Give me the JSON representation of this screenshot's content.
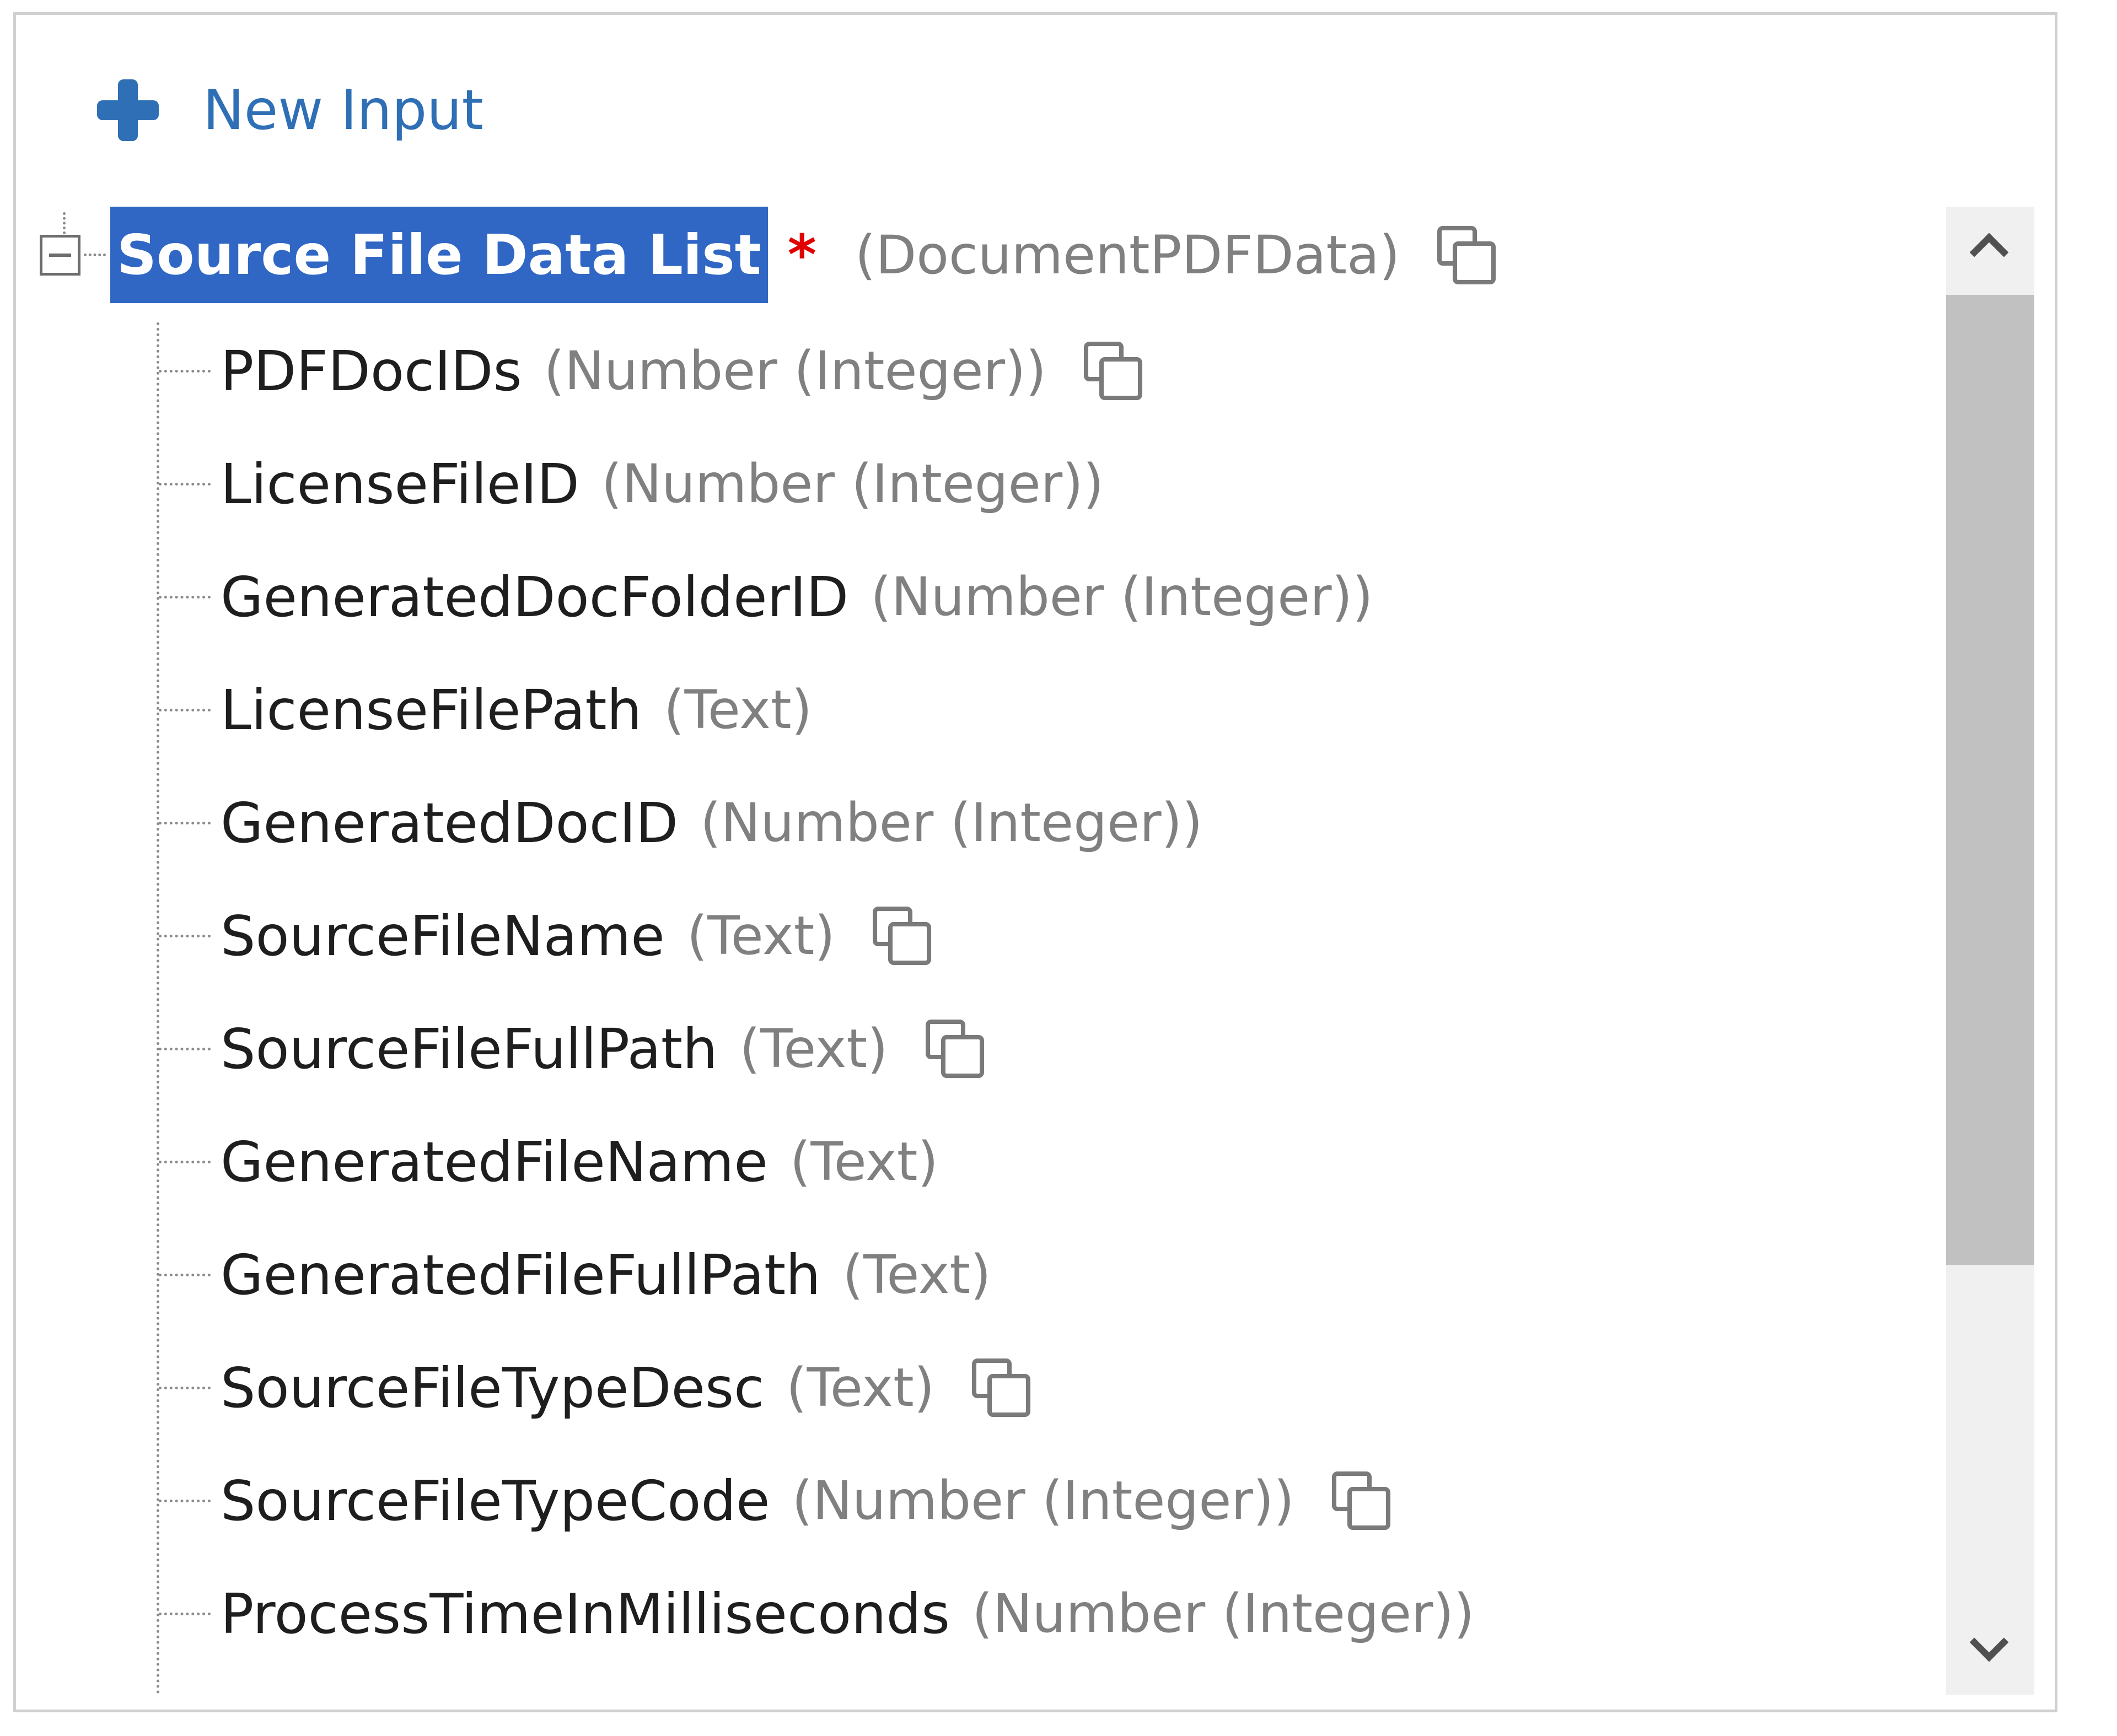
{
  "toolbar": {
    "new_input_label": "New Input",
    "new_input_icon": "plus-icon",
    "accent_color": "#2f6fb5"
  },
  "tree": {
    "root": {
      "label": "Source File Data List",
      "required_marker": "*",
      "type": "(DocumentPDFData)",
      "selected": true,
      "expanded": true,
      "has_copy_icon": true,
      "highlight_color": "#3167c4"
    },
    "children": [
      {
        "name": "PDFDocIDs",
        "type": "(Number (Integer))",
        "has_copy_icon": true
      },
      {
        "name": "LicenseFileID",
        "type": "(Number (Integer))",
        "has_copy_icon": false
      },
      {
        "name": "GeneratedDocFolderID",
        "type": "(Number (Integer))",
        "has_copy_icon": false
      },
      {
        "name": "LicenseFilePath",
        "type": "(Text)",
        "has_copy_icon": false
      },
      {
        "name": "GeneratedDocID",
        "type": "(Number (Integer))",
        "has_copy_icon": false
      },
      {
        "name": "SourceFileName",
        "type": "(Text)",
        "has_copy_icon": true
      },
      {
        "name": "SourceFileFullPath",
        "type": "(Text)",
        "has_copy_icon": true
      },
      {
        "name": "GeneratedFileName",
        "type": "(Text)",
        "has_copy_icon": false
      },
      {
        "name": "GeneratedFileFullPath",
        "type": "(Text)",
        "has_copy_icon": false
      },
      {
        "name": "SourceFileTypeDesc",
        "type": "(Text)",
        "has_copy_icon": true
      },
      {
        "name": "SourceFileTypeCode",
        "type": "(Number (Integer))",
        "has_copy_icon": true
      },
      {
        "name": "ProcessTimeInMilliseconds",
        "type": "(Number (Integer))",
        "has_copy_icon": false
      }
    ]
  },
  "scrollbar": {
    "up_icon": "chevron-up-icon",
    "down_icon": "chevron-down-icon"
  }
}
